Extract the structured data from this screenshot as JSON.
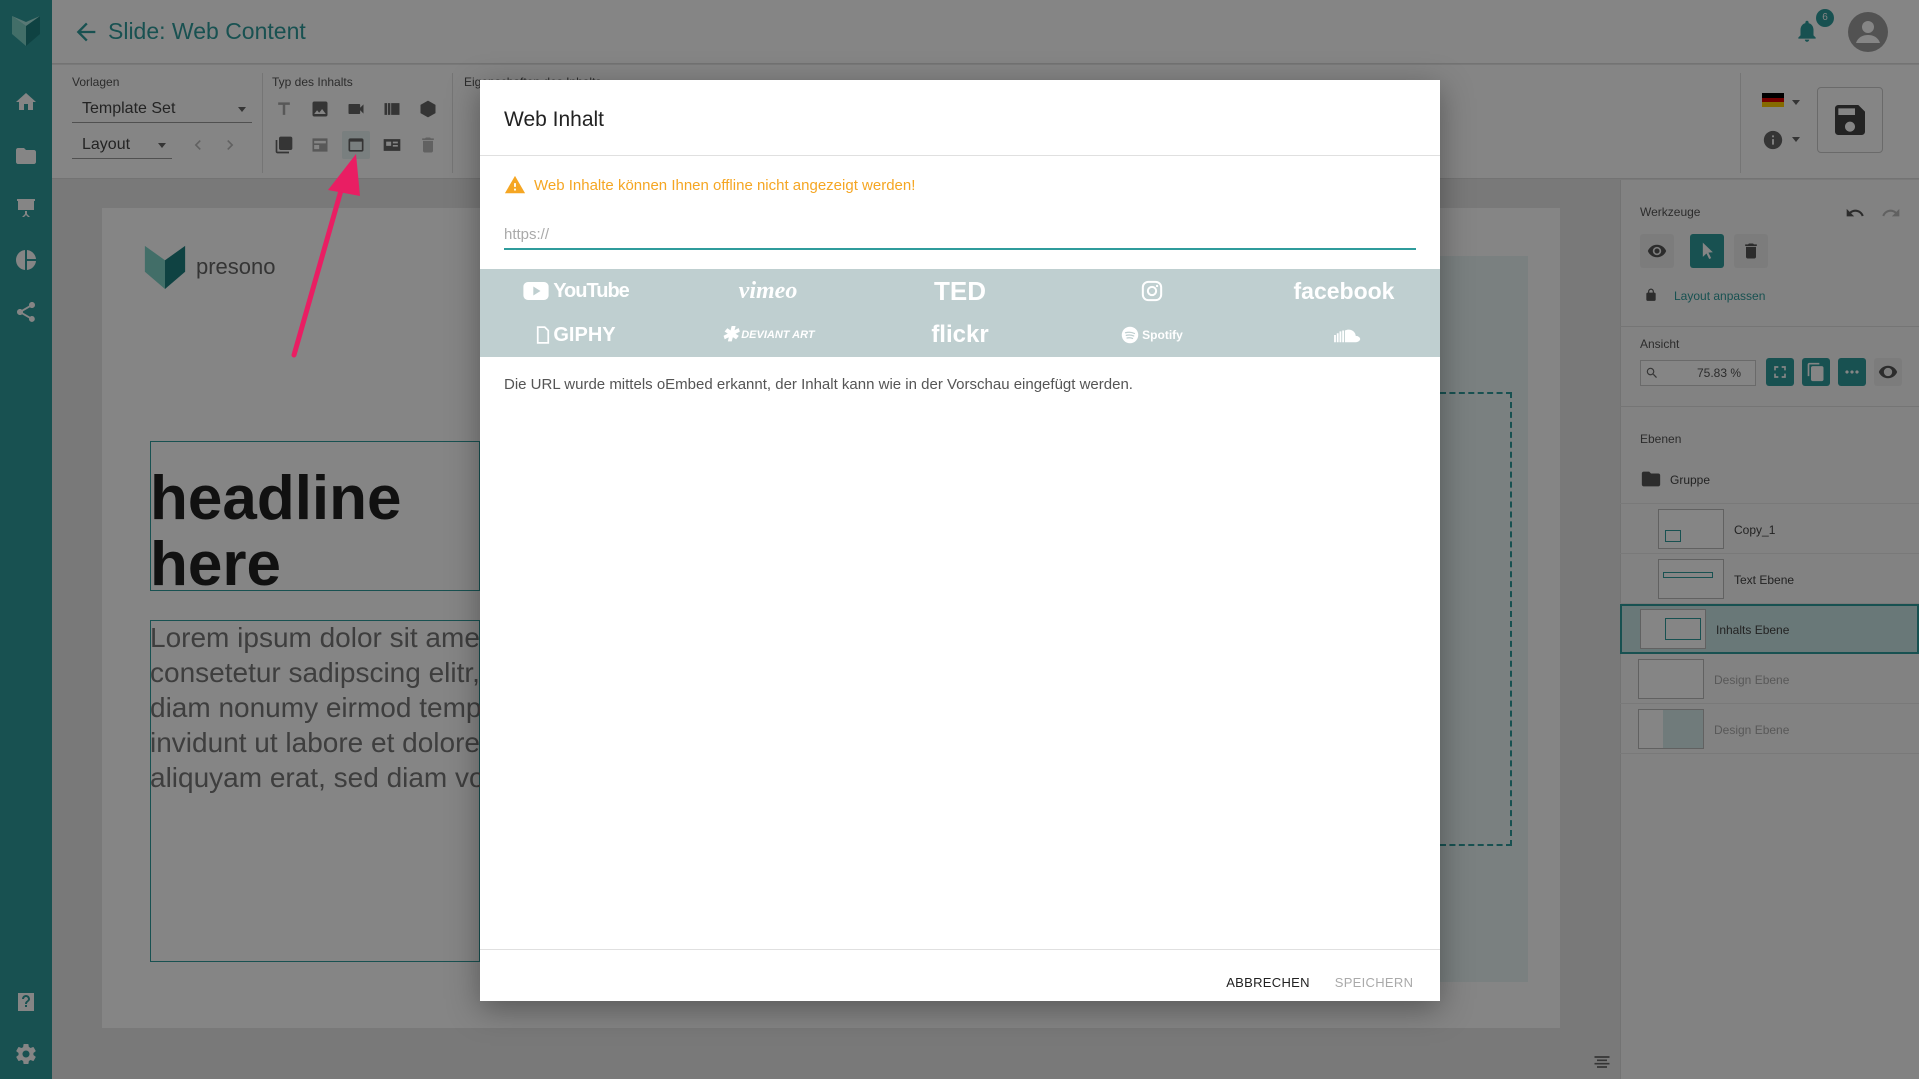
{
  "header": {
    "title": "Slide: Web Content",
    "notification_count": "6"
  },
  "nav": {
    "items": [
      "home-icon",
      "folder-icon",
      "presentation-icon",
      "chart-pie-icon",
      "share-icon"
    ],
    "bottom": [
      "help-icon",
      "gear-icon"
    ]
  },
  "toolbar": {
    "templates_label": "Vorlagen",
    "template_set": "Template Set",
    "layout": "Layout",
    "content_type_label": "Typ des Inhalts",
    "properties_label": "Eigenschaften des Inhalts"
  },
  "slide": {
    "logo_text": "presono",
    "headline": "headline\nhere",
    "body": "Lorem ipsum dolor sit amet,\nconsetetur sadipscing elitr, sed\ndiam nonumy eirmod tempor\ninvidunt ut labore et dolore\naliquyam erat, sed diam vol"
  },
  "rightpanel": {
    "tools_label": "Werkzeuge",
    "layout_adjust": "Layout anpassen",
    "view_label": "Ansicht",
    "zoom": "75.83 %",
    "layers_label": "Ebenen",
    "layers": [
      {
        "name": "Gruppe"
      },
      {
        "name": "Copy_1"
      },
      {
        "name": "Text Ebene"
      },
      {
        "name": "Inhalts Ebene"
      },
      {
        "name": "Design Ebene"
      },
      {
        "name": "Design Ebene"
      }
    ]
  },
  "dialog": {
    "title": "Web Inhalt",
    "warning": "Web Inhalte können Ihnen offline nicht angezeigt werden!",
    "url_placeholder": "https://",
    "providers": [
      "YouTube",
      "vimeo",
      "TED",
      "instagram",
      "facebook",
      "GIPHY",
      "DEVIANT ART",
      "flickr",
      "Spotify",
      "SoundCloud"
    ],
    "info": "Die URL wurde mittels oEmbed erkannt, der Inhalt kann wie in der Vorschau eingefügt werden.",
    "cancel": "ABBRECHEN",
    "save": "SPEICHERN"
  },
  "colors": {
    "brand": "#2f9c9c",
    "warning": "#f5a623",
    "arrow": "#e91e63"
  }
}
